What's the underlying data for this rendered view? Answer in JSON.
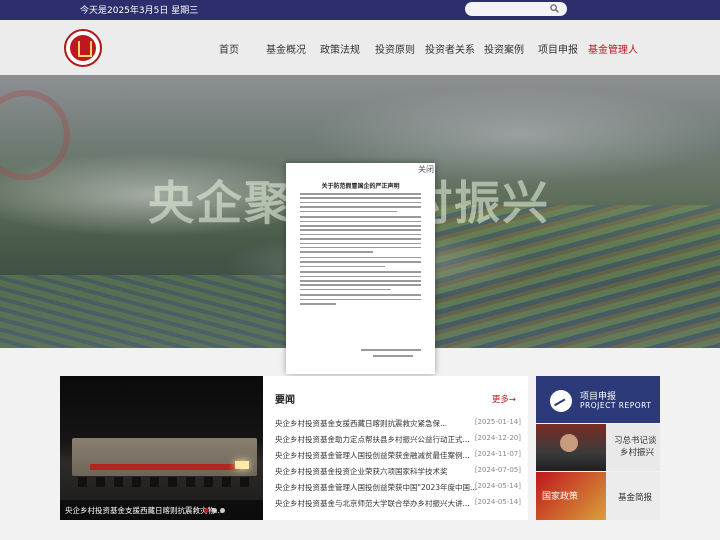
{
  "topbar": {
    "date": "今天是2025年3月5日 星期三",
    "search_placeholder": ""
  },
  "nav": {
    "items": [
      {
        "label": "首页"
      },
      {
        "label": "基金概况"
      },
      {
        "label": "政策法规"
      },
      {
        "label": "投资原则"
      },
      {
        "label": "投资者关系"
      },
      {
        "label": "投资案例"
      },
      {
        "label": "项目申报"
      },
      {
        "label": "基金管理人"
      }
    ],
    "active_index": 7
  },
  "hero": {
    "slogan": "央企聚力 乡村振兴"
  },
  "modal": {
    "title": "关于防范假冒国企的严正声明",
    "close_label": "关闭"
  },
  "photo_news": {
    "caption": "央企乡村投资基金支援西藏日喀则抗震救灾物...",
    "slides": 3,
    "active_slide": 0
  },
  "news": {
    "heading": "要闻",
    "more_label": "更多→",
    "items": [
      {
        "title": "央企乡村投资基金支援西藏日喀则抗震救灾紧急保...",
        "date": "[2025-01-14]"
      },
      {
        "title": "央企乡村投资基金助力定点帮扶县乡村振兴公益行动正式...",
        "date": "[2024-12-20]"
      },
      {
        "title": "央企乡村投资基金管理人国投创益荣获金融减贫最佳案例...",
        "date": "[2024-11-07]"
      },
      {
        "title": "央企乡村投资基金投资企业荣获六项国家科学技术奖",
        "date": "[2024-07-05]"
      },
      {
        "title": "央企乡村投资基金管理人国投创益荣获中国\"2023年度中国...",
        "date": "[2024-05-14]"
      },
      {
        "title": "央企乡村投资基金与北京师范大学联合举办乡村振兴大讲...",
        "date": "[2024-05-14]"
      }
    ]
  },
  "side": {
    "project": {
      "title": "项目申报",
      "subtitle": "PROJECT REPORT"
    },
    "xi": {
      "line1": "习总书记谈",
      "line2": "乡村振兴"
    },
    "policy": {
      "image_label": "国家政策",
      "label": "基金简报"
    }
  },
  "colors": {
    "brand_red": "#c0161d",
    "navy": "#2c2f6b"
  }
}
